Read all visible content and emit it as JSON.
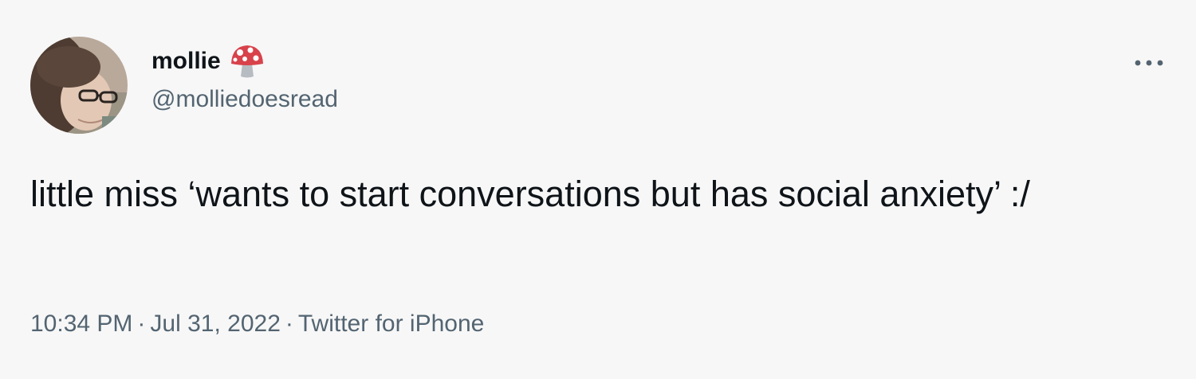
{
  "author": {
    "display_name": "mollie",
    "name_emoji_icon": "mushroom-icon",
    "handle": "@molliedoesread",
    "avatar_icon": "profile-photo"
  },
  "tweet": {
    "text": "little miss ‘wants to start conversations but has social anxiety’ :/",
    "time": "10:34 PM",
    "separator": "·",
    "date": "Jul 31, 2022",
    "source": "Twitter for iPhone"
  },
  "menu": {
    "more_icon": "more-dots-icon"
  },
  "colors": {
    "background": "#f7f7f7",
    "text_primary": "#0f1419",
    "text_secondary": "#536471",
    "mushroom_cap": "#d8424b"
  }
}
